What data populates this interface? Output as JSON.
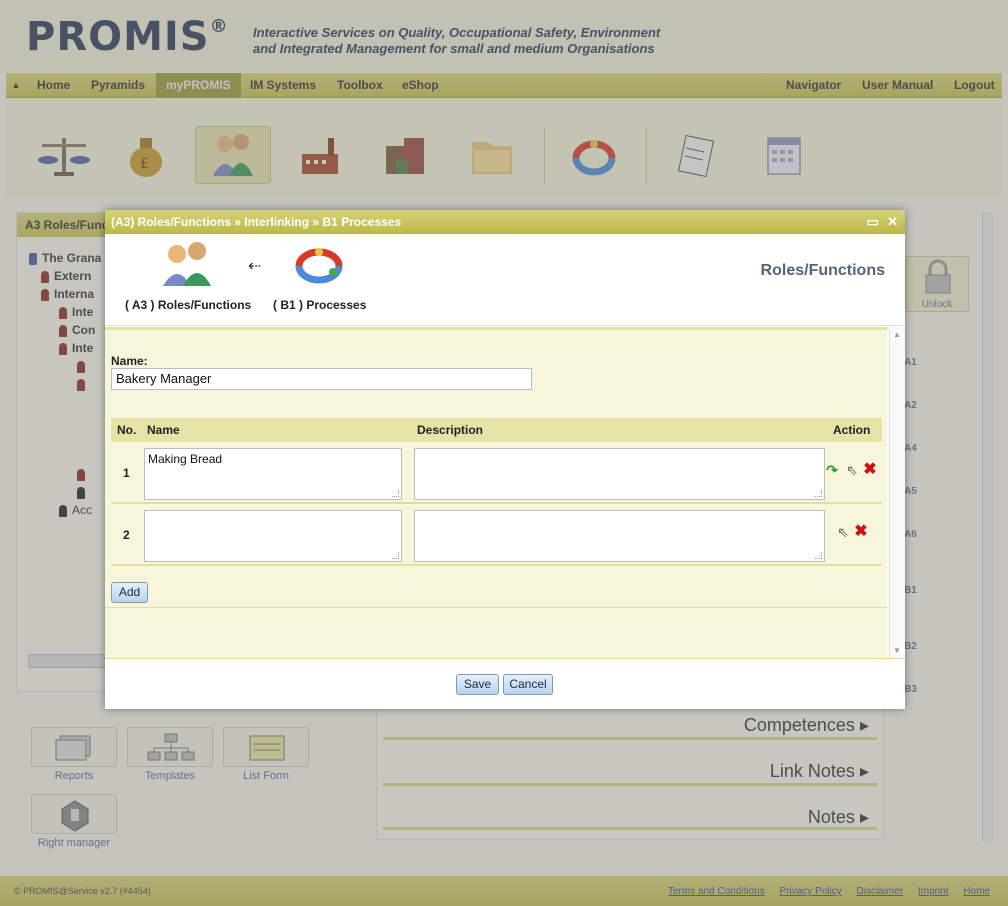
{
  "app": {
    "logo": "PROMIS",
    "logo_mark": "®",
    "tagline_line1": "Interactive Services on Quality, Occupational Safety, Environment",
    "tagline_line2": "and Integrated Management for small and medium Organisations"
  },
  "nav": {
    "collapse_glyph": "▲",
    "left": [
      "Home",
      "Pyramids",
      "myPROMIS",
      "IM Systems",
      "Toolbox",
      "eShop"
    ],
    "active": "myPROMIS",
    "right": [
      "Navigator",
      "User Manual",
      "Logout"
    ]
  },
  "iconbar": {
    "icons": [
      "scales-icon",
      "money-bag-icon",
      "people-icon",
      "factory-icon",
      "buildings-icon",
      "folder-icon",
      "cycle-arrows-icon",
      "clipboard-icon",
      "calendar-icon"
    ],
    "selected": "people-icon"
  },
  "left_panel": {
    "header": "A3 Roles/Func",
    "tree": [
      {
        "label": "The Grana"
      },
      {
        "label": "Extern"
      },
      {
        "label": "Interna"
      },
      {
        "label": "Inte"
      },
      {
        "label": "Con"
      },
      {
        "label": "Inte"
      },
      {
        "label": "Acc"
      }
    ],
    "tools": [
      {
        "label": "Reports",
        "icon": "reports-icon"
      },
      {
        "label": "Templates",
        "icon": "templates-icon"
      },
      {
        "label": "List Form",
        "icon": "list-form-icon"
      },
      {
        "label": "Right manager",
        "icon": "hand-stop-icon"
      }
    ]
  },
  "right_panel": {
    "sections": [
      "Competences",
      "Link Notes",
      "Notes"
    ],
    "expand_glyph": "▸"
  },
  "side_strip": {
    "unlock_label": "Unlock",
    "items": [
      "A1",
      "A2",
      "A4",
      "A5",
      "A6",
      "B1",
      "B2",
      "B3"
    ]
  },
  "footer": {
    "copyright": "© PROMIS@Service v2.7 (#4454)",
    "links": [
      "Terms and Conditions",
      "Privacy Policy",
      "Disclaimer",
      "Imprint",
      "Home"
    ]
  },
  "dialog": {
    "title_part1": "(A3) Roles/Functions",
    "separator": "»",
    "title_part2": "Interlinking",
    "title_part3": "B1 Processes",
    "maximize_glyph": "▭",
    "close_glyph": "✕",
    "from_label": "( A3 ) Roles/Functions",
    "to_label": "( B1 ) Processes",
    "heading": "Roles/Functions",
    "name_label": "Name:",
    "name_value": "Bakery Manager",
    "columns": {
      "no": "No.",
      "name": "Name",
      "description": "Description",
      "action": "Action"
    },
    "rows": [
      {
        "no": "1",
        "name": "Making Bread",
        "description": ""
      },
      {
        "no": "2",
        "name": "",
        "description": ""
      }
    ],
    "add_label": "Add",
    "save_label": "Save",
    "cancel_label": "Cancel"
  }
}
